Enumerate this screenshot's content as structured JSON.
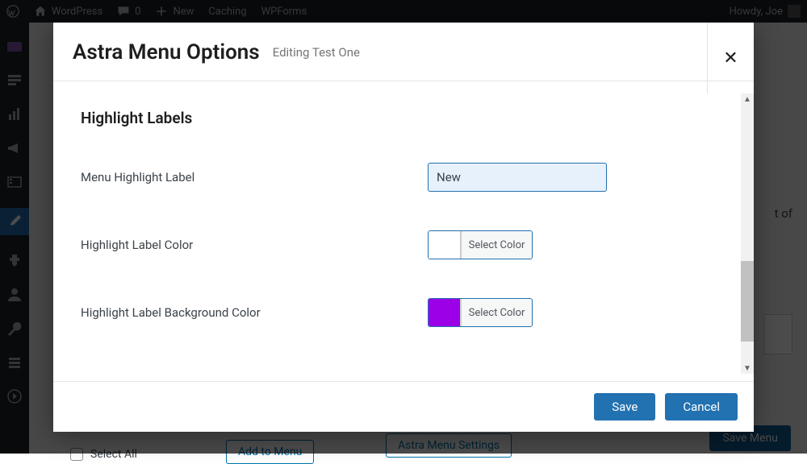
{
  "adminbar": {
    "site_name": "WordPress",
    "comments": "0",
    "new_label": "New",
    "caching": "Caching",
    "wpforms": "WPForms",
    "howdy": "Howdy, Joe"
  },
  "background": {
    "select_all": "Select All",
    "add_to_menu": "Add to Menu",
    "astra_menu_settings": "Astra Menu Settings",
    "save_menu": "Save Menu",
    "partial_text_right": "t of"
  },
  "modal": {
    "title": "Astra Menu Options",
    "subtitle": "Editing Test One",
    "section_title": "Highlight Labels",
    "fields": {
      "highlight_label": {
        "label": "Menu Highlight Label",
        "value": "New"
      },
      "label_color": {
        "label": "Highlight Label Color",
        "button": "Select Color",
        "swatch": "#ffffff"
      },
      "label_bg_color": {
        "label": "Highlight Label Background Color",
        "button": "Select Color",
        "swatch": "#9b00e6"
      }
    },
    "footer": {
      "save": "Save",
      "cancel": "Cancel"
    }
  }
}
